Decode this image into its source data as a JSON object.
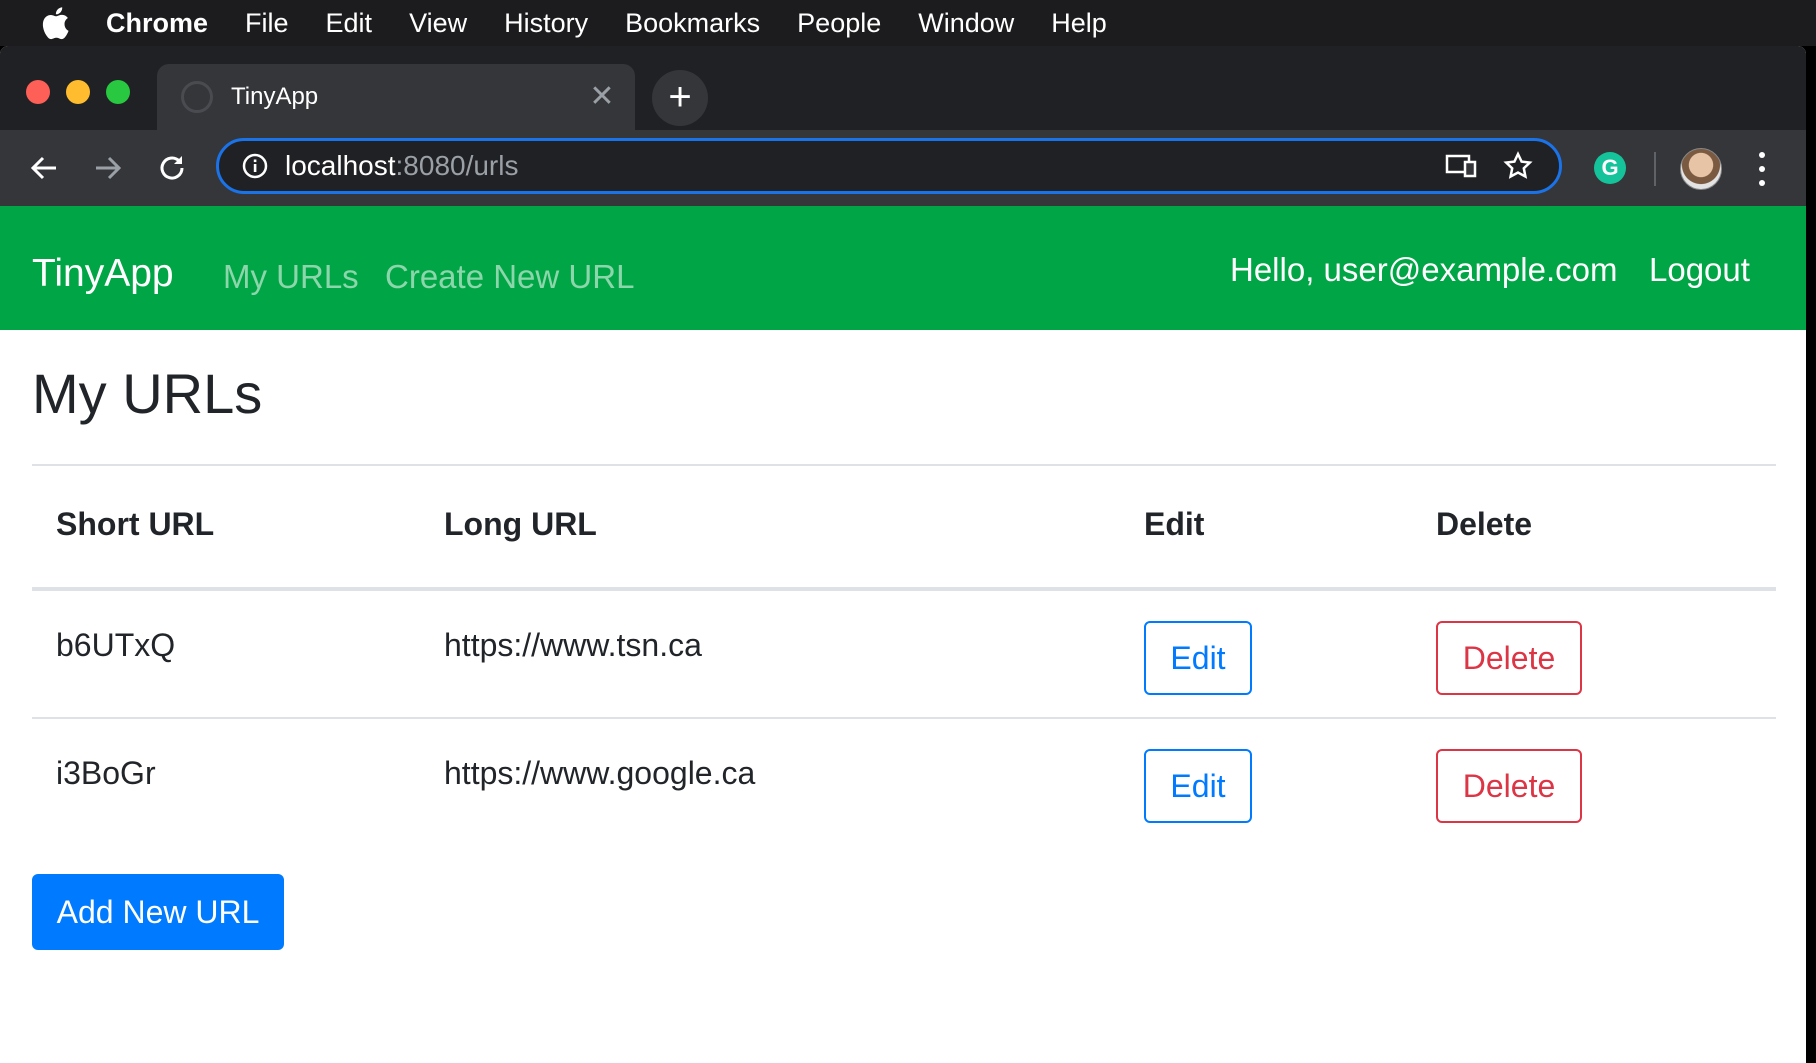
{
  "menubar": {
    "app": "Chrome",
    "items": [
      "File",
      "Edit",
      "View",
      "History",
      "Bookmarks",
      "People",
      "Window",
      "Help"
    ]
  },
  "browser": {
    "tab_title": "TinyApp",
    "new_tab_symbol": "+",
    "close_symbol": "✕",
    "url_host": "localhost",
    "url_path": ":8080/urls",
    "extension_letter": "G"
  },
  "navbar": {
    "brand": "TinyApp",
    "links": [
      "My URLs",
      "Create New URL"
    ],
    "greeting": "Hello, user@example.com",
    "logout": "Logout"
  },
  "main": {
    "heading": "My URLs",
    "table": {
      "headers": [
        "Short URL",
        "Long URL",
        "Edit",
        "Delete"
      ],
      "rows": [
        {
          "short_url": "b6UTxQ",
          "long_url": "https://www.tsn.ca",
          "edit_label": "Edit",
          "delete_label": "Delete"
        },
        {
          "short_url": "i3BoGr",
          "long_url": "https://www.google.ca",
          "edit_label": "Edit",
          "delete_label": "Delete"
        }
      ]
    },
    "add_button": "Add New URL"
  },
  "colors": {
    "navbar_bg": "#00a545",
    "primary": "#007bff",
    "danger": "#dc3545",
    "omnibox_focus": "#1a73e8"
  },
  "icons": [
    "apple-icon",
    "favicon-icon",
    "close-icon",
    "plus-icon",
    "back-arrow-icon",
    "forward-arrow-icon",
    "reload-icon",
    "info-icon",
    "cast-icon",
    "star-icon",
    "grammarly-icon",
    "profile-avatar",
    "more-vert-icon"
  ]
}
